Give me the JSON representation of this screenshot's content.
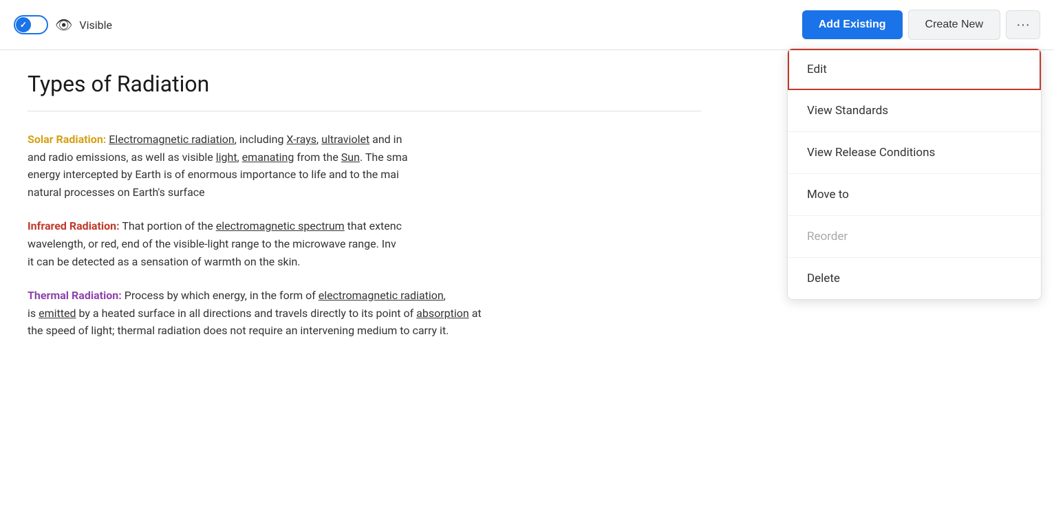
{
  "toolbar": {
    "visible_label": "Visible",
    "add_existing_label": "Add Existing",
    "create_new_label": "Create New",
    "more_icon": "···"
  },
  "dropdown": {
    "items": [
      {
        "id": "edit",
        "label": "Edit",
        "active": true,
        "disabled": false
      },
      {
        "id": "view-standards",
        "label": "View Standards",
        "active": false,
        "disabled": false
      },
      {
        "id": "view-release-conditions",
        "label": "View Release Conditions",
        "active": false,
        "disabled": false
      },
      {
        "id": "move-to",
        "label": "Move to",
        "active": false,
        "disabled": false
      },
      {
        "id": "reorder",
        "label": "Reorder",
        "active": false,
        "disabled": true
      },
      {
        "id": "delete",
        "label": "Delete",
        "active": false,
        "disabled": false
      }
    ]
  },
  "content": {
    "title": "Types of Radiation",
    "sections": [
      {
        "id": "solar",
        "label": "Solar Radiation:",
        "text": " Electromagnetic radiation, including X-rays, ultraviolet and infrared and radio emissions, as well as visible light, emanating from the Sun. The small fraction of energy intercepted by Earth is of enormous importance to life and to the maintenance of natural processes on Earth's surface"
      },
      {
        "id": "infrared",
        "label": "Infrared Radiation:",
        "text": " That portion of the electromagnetic spectrum that extends from the long wavelength, or red, end of the visible-light range to the microwave range. Invisible to the eye, it can be detected as a sensation of warmth on the skin."
      },
      {
        "id": "thermal",
        "label": "Thermal Radiation:",
        "text": " Process by which energy, in the form of electromagnetic radiation, is emitted by a heated surface in all directions and travels directly to its point of absorption at the speed of light; thermal radiation does not require an intervening medium to carry it."
      }
    ]
  }
}
